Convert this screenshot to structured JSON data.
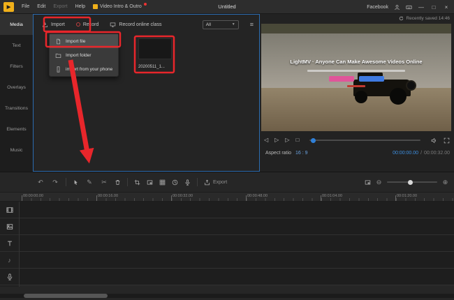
{
  "colors": {
    "accent": "#2f80d8",
    "annotation_red": "#e8262b",
    "logo_yellow": "#f0b01a"
  },
  "icons": {
    "logo_play": "▶",
    "undo": "↶",
    "redo": "↷",
    "cursor": "↖",
    "pen": "✎",
    "scissors": "✂",
    "caret": "▼",
    "list_view": "≡",
    "step_back": "◁",
    "play": "▷",
    "step_forward": "▷",
    "stop": "□",
    "zoom_in": "⊕",
    "zoom_out": "⊖",
    "music_note": "♪",
    "minimize": "—",
    "maximize": "□",
    "close": "×"
  },
  "titlebar": {
    "title": "Untitled",
    "menu": {
      "file": "File",
      "edit": "Edit",
      "export": "Export",
      "help": "Help",
      "intro_outro": "Video Intro & Outro"
    },
    "facebook": "Facebook"
  },
  "sidebar": {
    "items": [
      {
        "label": "Media",
        "active": true
      },
      {
        "label": "Text"
      },
      {
        "label": "Filters"
      },
      {
        "label": "Overlays"
      },
      {
        "label": "Transitions"
      },
      {
        "label": "Elements"
      },
      {
        "label": "Music"
      }
    ]
  },
  "media": {
    "toolbar": {
      "import": "Import",
      "record": "Record",
      "record_online": "Record online class",
      "filter_all": "All"
    },
    "menu": {
      "items": [
        {
          "label": "Import file",
          "highlighted": true
        },
        {
          "label": "Import folder"
        },
        {
          "label": "import from your phone"
        }
      ]
    },
    "clip": {
      "name": "20200511_1..."
    }
  },
  "preview": {
    "saved": "Recently saved 14:46",
    "headline": "LightMV · Anyone Can Make Awesome Videos Online",
    "aspect_label": "Aspect ratio",
    "aspect_value": "16 : 9",
    "current_time": "00:00:00.00",
    "separator": "/",
    "total_time": "00:00:32.00"
  },
  "timeline": {
    "export": "Export",
    "ruler": [
      "00:00:00.00",
      "00:00:16.00",
      "00:00:32.00",
      "00:00:48.00",
      "00:01:04.00",
      "00:01:20.00"
    ],
    "tracks": [
      "video-track",
      "overlay-track",
      "text-track",
      "music-track",
      "voiceover-track"
    ]
  }
}
